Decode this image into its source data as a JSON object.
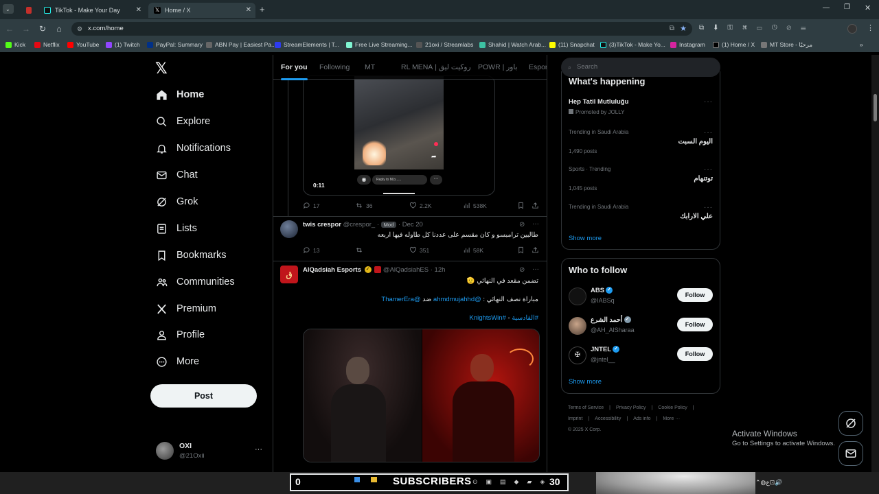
{
  "browser": {
    "tabs": [
      {
        "title": "TikTok - Make Your Day"
      },
      {
        "title": "Home / X"
      }
    ],
    "url": "x.com/home",
    "bookmarks": [
      "Kick",
      "Netflix",
      "YouTube",
      "(1) Twitch",
      "PayPal: Summary",
      "ABN Pay | Easiest Pa...",
      "StreamElements | T...",
      "Free Live Streaming...",
      "21oxi / Streamlabs",
      "Shahid | Watch Arab...",
      "(11) Snapchat",
      "(3)TikTok - Make Yo...",
      "Instagram",
      "(1) Home / X",
      "MT Store - مرحبًا"
    ]
  },
  "sidebar": {
    "logo": "𝕏",
    "items": [
      {
        "label": "Home",
        "icon": "home-icon"
      },
      {
        "label": "Explore",
        "icon": "search-icon"
      },
      {
        "label": "Notifications",
        "icon": "bell-icon"
      },
      {
        "label": "Chat",
        "icon": "mail-icon"
      },
      {
        "label": "Grok",
        "icon": "grok-icon"
      },
      {
        "label": "Lists",
        "icon": "list-icon"
      },
      {
        "label": "Bookmarks",
        "icon": "bookmark-icon"
      },
      {
        "label": "Communities",
        "icon": "communities-icon"
      },
      {
        "label": "Premium",
        "icon": "x-icon"
      },
      {
        "label": "Profile",
        "icon": "person-icon"
      },
      {
        "label": "More",
        "icon": "more-circle-icon"
      }
    ],
    "post_label": "Post",
    "account": {
      "name": "OXI",
      "handle": "@21Oxii",
      "more": "···"
    }
  },
  "feed": {
    "tabs": [
      "For you",
      "Following",
      "MT",
      "روكيت ليق | RL MENA",
      "POWR | باور",
      "Espor"
    ],
    "video": {
      "time": "0:11",
      "reply_placeholder": "Reply to M.b......"
    },
    "post1_stats": {
      "replies": "17",
      "reposts": "36",
      "likes": "2.2K",
      "views": "538K"
    },
    "post2": {
      "name": "twis crespor",
      "handle": "@crespor_",
      "badge": "Mod",
      "date": "Dec 20",
      "text": "طالبين ترامبسو و كان مقسم على عددنا كل طاوله فيها اربعه",
      "stats": {
        "replies": "13",
        "reposts": "",
        "likes": "351",
        "views": "58K"
      }
    },
    "post3": {
      "name": "AlQadsiah Esports",
      "handle": "@AlQadsiahES",
      "time": "12h",
      "line1": "تضمن مقعد في النهائي 🫡",
      "line2_prefix": "مباراة نصف النهائي : ",
      "mention1": "@ahmdmujahhd",
      "vs": " ضد ",
      "mention2": "@ThamerEra",
      "hashtag1": "#القادسية",
      "dash": " - ",
      "hashtag2": "#KnightsWin"
    }
  },
  "right": {
    "search_placeholder": "Search",
    "whats_happening": "What's happening",
    "promo": {
      "title": "Hep Tatil Mutluluğu",
      "promoted": "Promoted by JOLLY"
    },
    "trends": [
      {
        "category": "Trending in Saudi Arabia",
        "name": "اليوم السبت",
        "count": "1,490 posts"
      },
      {
        "category": "Sports · Trending",
        "name": "توتنهام",
        "count": "1,045 posts"
      },
      {
        "category": "Trending in Saudi Arabia",
        "name": "علي الارابك",
        "count": ""
      }
    ],
    "show_more": "Show more",
    "who_to_follow": "Who to follow",
    "follow_label": "Follow",
    "suggestions": [
      {
        "name": "ABS",
        "handle": "@IABSq"
      },
      {
        "name": "أحمد الشرع",
        "handle": "@AH_AlSharaa"
      },
      {
        "name": "JNTEL",
        "handle": "@jntel__"
      }
    ],
    "footer": [
      "Terms of Service",
      "Privacy Policy",
      "Cookie Policy",
      "Imprint",
      "Accessibility",
      "Ads info",
      "More ···",
      "© 2025 X Corp."
    ]
  },
  "overlay": {
    "activate_title": "Activate Windows",
    "activate_sub": "Go to Settings to activate Windows.",
    "subscribers_label": "SUBSCRIBERS",
    "subscribers_left": "0",
    "subscribers_right": "30"
  }
}
